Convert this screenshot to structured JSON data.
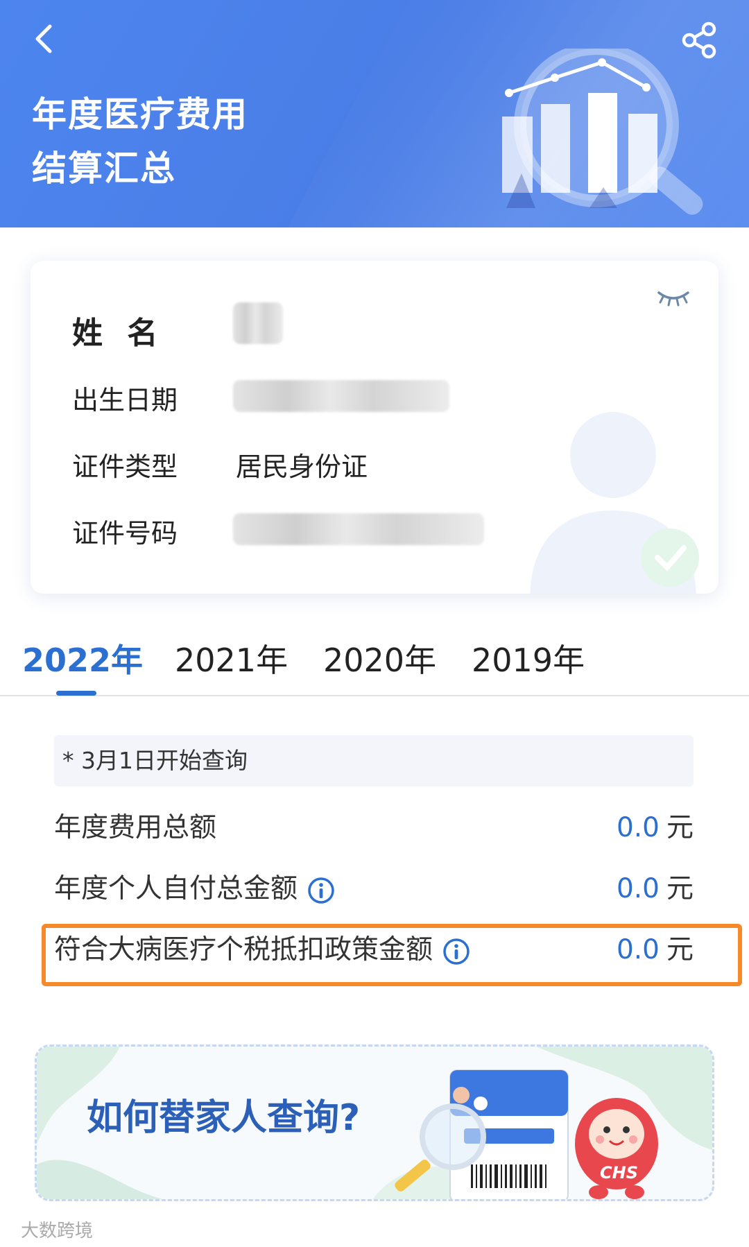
{
  "header": {
    "title_line1": "年度医疗费用",
    "title_line2": "结算汇总",
    "back_icon": "chevron-left-icon",
    "share_icon": "share-icon"
  },
  "profile": {
    "name_label": "姓 名",
    "birthdate_label": "出生日期",
    "id_type_label": "证件类型",
    "id_type_value": "居民身份证",
    "id_number_label": "证件号码",
    "visibility_icon": "eye-closed-icon"
  },
  "tabs": [
    {
      "label": "2022年",
      "active": true
    },
    {
      "label": "2021年",
      "active": false
    },
    {
      "label": "2020年",
      "active": false
    },
    {
      "label": "2019年",
      "active": false
    }
  ],
  "note": "* 3月1日开始查询",
  "amounts": [
    {
      "label": "年度费用总额",
      "value": "0.0",
      "unit": "元",
      "has_info": false
    },
    {
      "label": "年度个人自付总金额",
      "value": "0.0",
      "unit": "元",
      "has_info": true
    },
    {
      "label": "符合大病医疗个税抵扣政策金额",
      "value": "0.0",
      "unit": "元",
      "has_info": true
    }
  ],
  "banner": {
    "text": "如何替家人查询?",
    "mascot_text": "CHS"
  },
  "watermark": "大数跨境",
  "colors": {
    "header_bg": "#4a7de6",
    "accent": "#2b6fd0",
    "highlight": "#f68a2b"
  }
}
